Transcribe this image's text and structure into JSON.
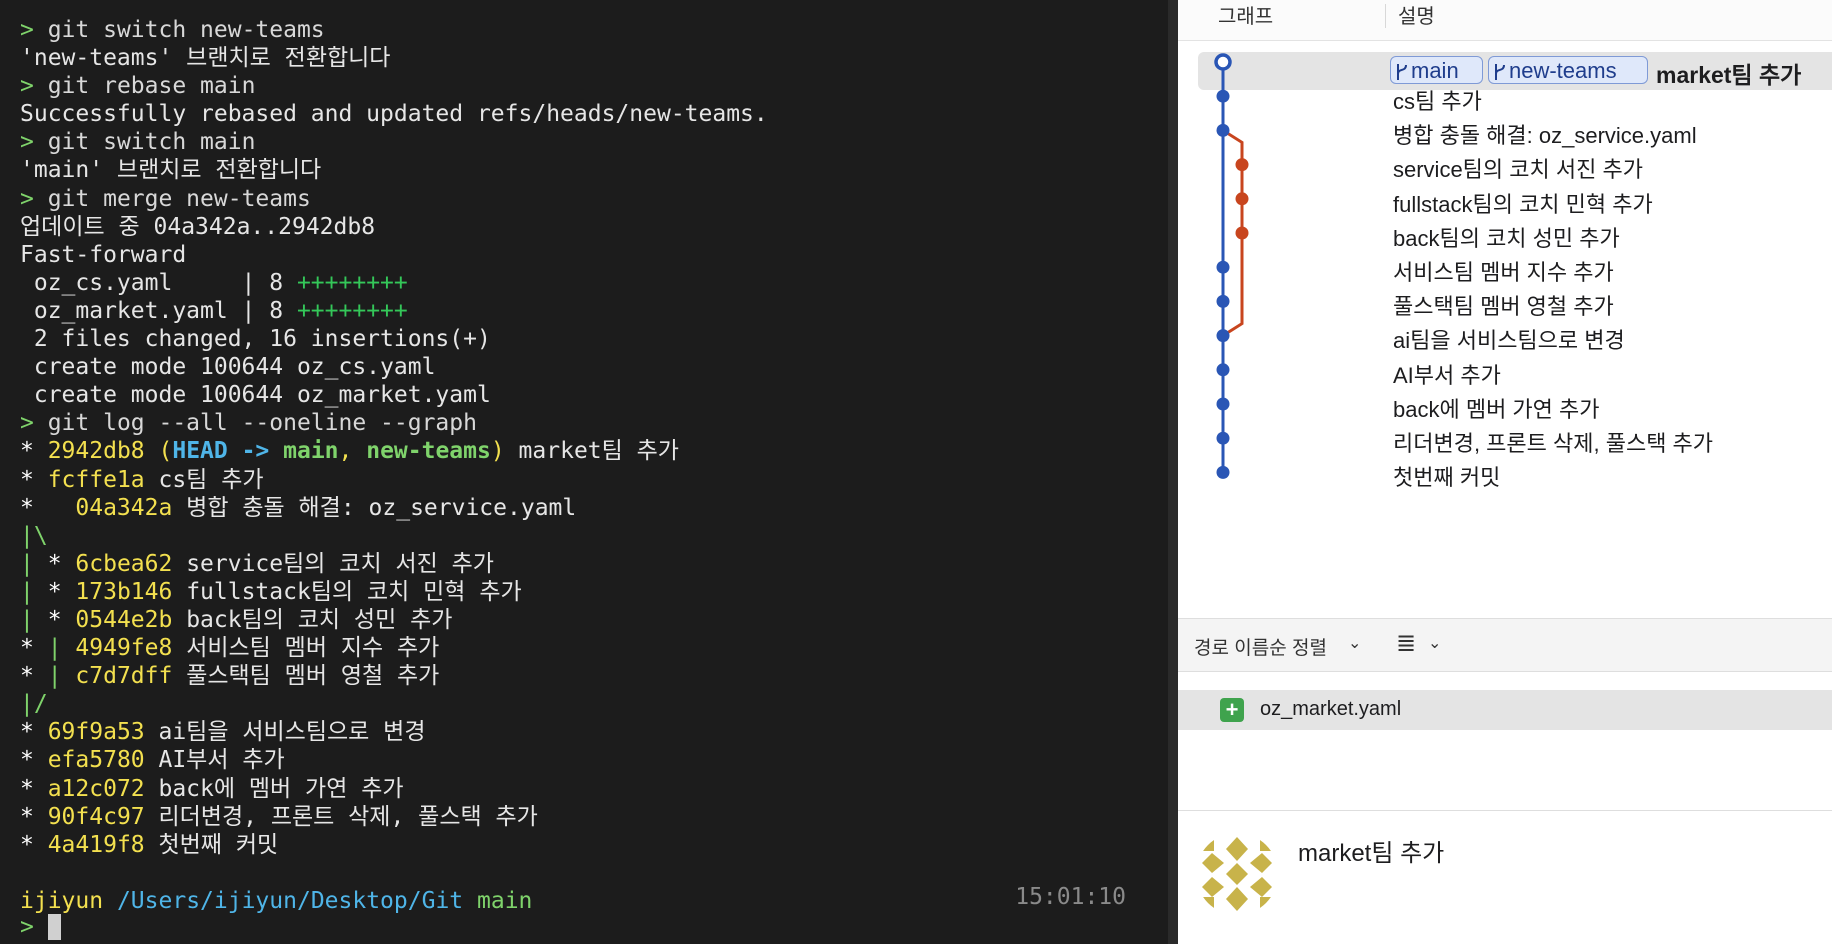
{
  "terminal": {
    "lines": [
      [
        [
          "p",
          "> "
        ],
        [
          "cmd",
          "git switch new-teams"
        ]
      ],
      [
        [
          "",
          "'new-teams' 브랜치로 전환합니다"
        ]
      ],
      [
        [
          "p",
          "> "
        ],
        [
          "cmd",
          "git rebase main"
        ]
      ],
      [
        [
          "",
          "Successfully rebased and updated refs/heads/new-teams."
        ]
      ],
      [
        [
          "p",
          "> "
        ],
        [
          "cmd",
          "git switch main"
        ]
      ],
      [
        [
          "",
          "'main' 브랜치로 전환합니다"
        ]
      ],
      [
        [
          "p",
          "> "
        ],
        [
          "cmd",
          "git merge new-teams"
        ]
      ],
      [
        [
          "",
          "업데이트 중 04a342a..2942db8"
        ]
      ],
      [
        [
          "",
          "Fast-forward"
        ]
      ],
      [
        [
          "",
          " oz_cs.yaml     | 8 "
        ],
        [
          "grn",
          "++++++++"
        ]
      ],
      [
        [
          "",
          " oz_market.yaml | 8 "
        ],
        [
          "grn",
          "++++++++"
        ]
      ],
      [
        [
          "",
          " 2 files changed, 16 insertions(+)"
        ]
      ],
      [
        [
          "",
          " create mode 100644 oz_cs.yaml"
        ]
      ],
      [
        [
          "",
          " create mode 100644 oz_market.yaml"
        ]
      ],
      [
        [
          "p",
          "> "
        ],
        [
          "cmd",
          "git log --all --oneline --graph"
        ]
      ],
      [
        [
          "star",
          "* "
        ],
        [
          "hash",
          "2942db8 "
        ],
        [
          "par",
          "("
        ],
        [
          "head",
          "HEAD -> "
        ],
        [
          "br",
          "main"
        ],
        [
          "par",
          ", "
        ],
        [
          "br",
          "new-teams"
        ],
        [
          "par",
          ")"
        ],
        [
          "",
          " market팀 추가"
        ]
      ],
      [
        [
          "star",
          "* "
        ],
        [
          "hash",
          "fcffe1a"
        ],
        [
          "",
          " cs팀 추가"
        ]
      ],
      [
        [
          "star",
          "*   "
        ],
        [
          "hash",
          "04a342a"
        ],
        [
          "",
          " 병합 충돌 해결: oz_service.yaml"
        ]
      ],
      [
        [
          "gl",
          "|\\"
        ]
      ],
      [
        [
          "gl",
          "| "
        ],
        [
          "star",
          "* "
        ],
        [
          "hash",
          "6cbea62"
        ],
        [
          "",
          " service팀의 코치 서진 추가"
        ]
      ],
      [
        [
          "gl",
          "| "
        ],
        [
          "star",
          "* "
        ],
        [
          "hash",
          "173b146"
        ],
        [
          "",
          " fullstack팀의 코치 민혁 추가"
        ]
      ],
      [
        [
          "gl",
          "| "
        ],
        [
          "star",
          "* "
        ],
        [
          "hash",
          "0544e2b"
        ],
        [
          "",
          " back팀의 코치 성민 추가"
        ]
      ],
      [
        [
          "star",
          "* "
        ],
        [
          "gl",
          "| "
        ],
        [
          "hash",
          "4949fe8"
        ],
        [
          "",
          " 서비스팀 멤버 지수 추가"
        ]
      ],
      [
        [
          "star",
          "* "
        ],
        [
          "gl",
          "| "
        ],
        [
          "hash",
          "c7d7dff"
        ],
        [
          "",
          " 풀스택팀 멤버 영철 추가"
        ]
      ],
      [
        [
          "gl",
          "|/"
        ]
      ],
      [
        [
          "star",
          "* "
        ],
        [
          "hash",
          "69f9a53"
        ],
        [
          "",
          " ai팀을 서비스팀으로 변경"
        ]
      ],
      [
        [
          "star",
          "* "
        ],
        [
          "hash",
          "efa5780"
        ],
        [
          "",
          " AI부서 추가"
        ]
      ],
      [
        [
          "star",
          "* "
        ],
        [
          "hash",
          "a12c072"
        ],
        [
          "",
          " back에 멤버 가연 추가"
        ]
      ],
      [
        [
          "star",
          "* "
        ],
        [
          "hash",
          "90f4c97"
        ],
        [
          "",
          " 리더변경, 프론트 삭제, 풀스택 추가"
        ]
      ],
      [
        [
          "star",
          "* "
        ],
        [
          "hash",
          "4a419f8"
        ],
        [
          "",
          " 첫번째 커밋"
        ]
      ],
      [
        [
          "",
          " "
        ]
      ],
      [
        [
          "usr",
          "ijiyun"
        ],
        [
          "",
          " "
        ],
        [
          "pth",
          "/Users/ijiyun/Desktop/Git"
        ],
        [
          "",
          " "
        ],
        [
          "brn",
          "main"
        ]
      ]
    ],
    "time": "15:01:10",
    "prompt": ">"
  },
  "gui": {
    "header": {
      "graph": "그래프",
      "description": "설명"
    },
    "badges": {
      "main": "main",
      "new_teams": "new-teams"
    },
    "selected_title": "market팀 추가",
    "commits": [
      "cs팀 추가",
      "병합 충돌 해결: oz_service.yaml",
      "service팀의 코치 서진 추가",
      "fullstack팀의 코치 민혁 추가",
      "back팀의 코치 성민 추가",
      "서비스팀 멤버 지수 추가",
      "풀스택팀 멤버 영철 추가",
      "ai팀을 서비스팀으로 변경",
      "AI부서 추가",
      "back에 멤버 가연 추가",
      "리더변경, 프론트 삭제, 풀스택 추가",
      "첫번째 커밋"
    ],
    "sort_label": "경로 이름순 정렬",
    "view_icon": "≣",
    "chevron": "⌄",
    "file": {
      "icon": "+",
      "name": "oz_market.yaml"
    },
    "detail_title": "market팀 추가",
    "colors": {
      "main_line": "#2a56b5",
      "branch_line": "#c8451e"
    }
  }
}
